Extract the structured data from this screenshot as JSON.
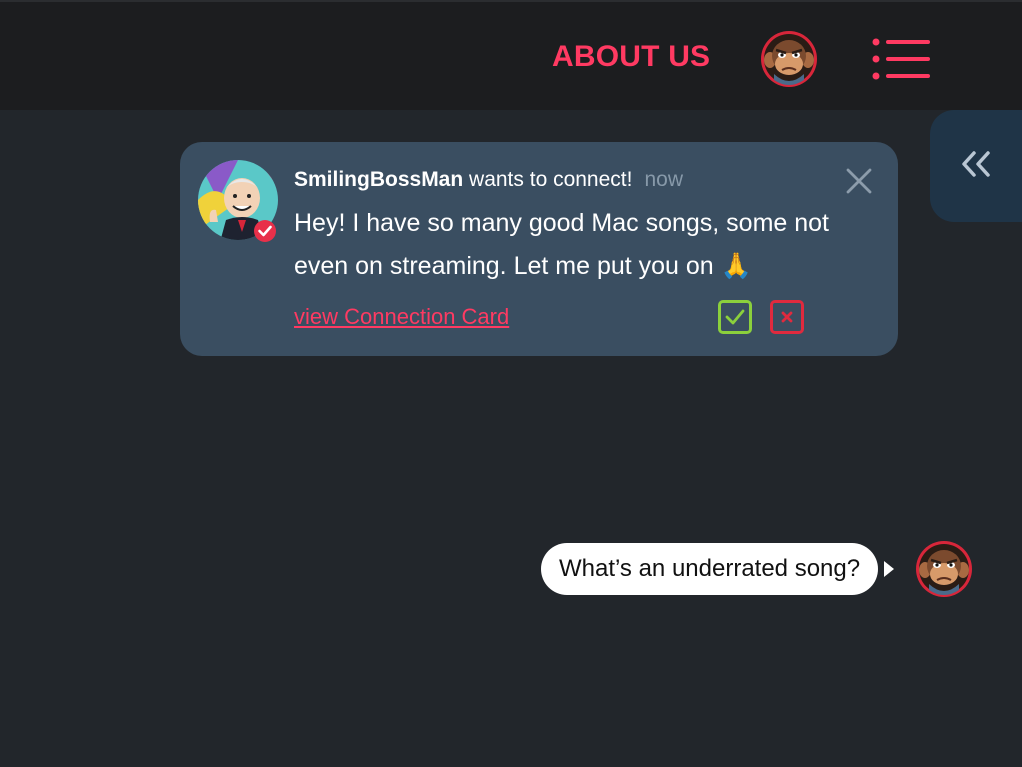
{
  "header": {
    "about_label": "ABOUT US",
    "accent": "#ff3a62",
    "avatar_icon": "monkey-avatar-icon",
    "menu_icon": "list-menu-icon"
  },
  "side_panel": {
    "toggle_icon": "double-chevron-left-icon"
  },
  "notification": {
    "sender": "SmilingBossMan",
    "action_text": " wants to connect!",
    "time": "now",
    "message": "Hey! I have so many good Mac songs, some not even on streaming. Let me put you on 🙏",
    "link_label": "view Connection Card",
    "accept_icon": "check-icon",
    "decline_icon": "x-icon",
    "accept_color": "#8bd03c",
    "decline_color": "#e02a3e",
    "verified_icon": "verified-badge-icon"
  },
  "chat": {
    "message": "What’s an underrated song?"
  }
}
